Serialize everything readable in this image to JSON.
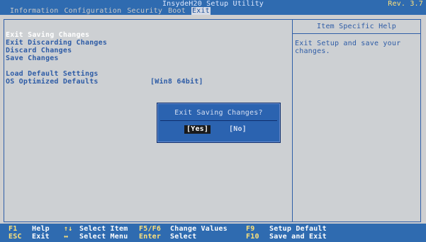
{
  "header": {
    "title": "InsydeH20 Setup Utility",
    "revision": "Rev. 3.7",
    "menu": [
      {
        "label": "Information"
      },
      {
        "label": "Configuration"
      },
      {
        "label": "Security"
      },
      {
        "label": "Boot"
      },
      {
        "label": "Exit"
      }
    ]
  },
  "options": [
    {
      "label": "Exit Saving Changes"
    },
    {
      "label": "Exit Discarding Changes"
    },
    {
      "label": "Discard Changes"
    },
    {
      "label": "Save Changes"
    },
    {
      "label": "Load Default Settings"
    },
    {
      "label": "OS Optimized Defaults",
      "value": "[Win8 64bit]"
    }
  ],
  "help": {
    "title": "Item Specific Help",
    "text": "Exit Setup and save your changes."
  },
  "dialog": {
    "question": "Exit Saving Changes?",
    "yes": "[Yes]",
    "no": "[No]"
  },
  "footer": {
    "rows": [
      [
        {
          "key": "F1",
          "desc": "Help"
        },
        {
          "key": "↑↓",
          "desc": "Select Item"
        },
        {
          "key": "F5/F6",
          "desc": "Change Values"
        },
        {
          "key": "F9",
          "desc": "Setup Default"
        }
      ],
      [
        {
          "key": "ESC",
          "desc": "Exit"
        },
        {
          "key": "↔",
          "desc": "Select Menu"
        },
        {
          "key": "Enter",
          "desc": "Select"
        },
        {
          "key": "F10",
          "desc": "Save and Exit"
        }
      ]
    ]
  },
  "colors": {
    "bar_blue": "#2f6bb0",
    "panel_gray": "#cdd0d3",
    "text_blue": "#2e5ca6",
    "key_yellow": "#ffe27a",
    "selected_white": "#ffffff"
  }
}
